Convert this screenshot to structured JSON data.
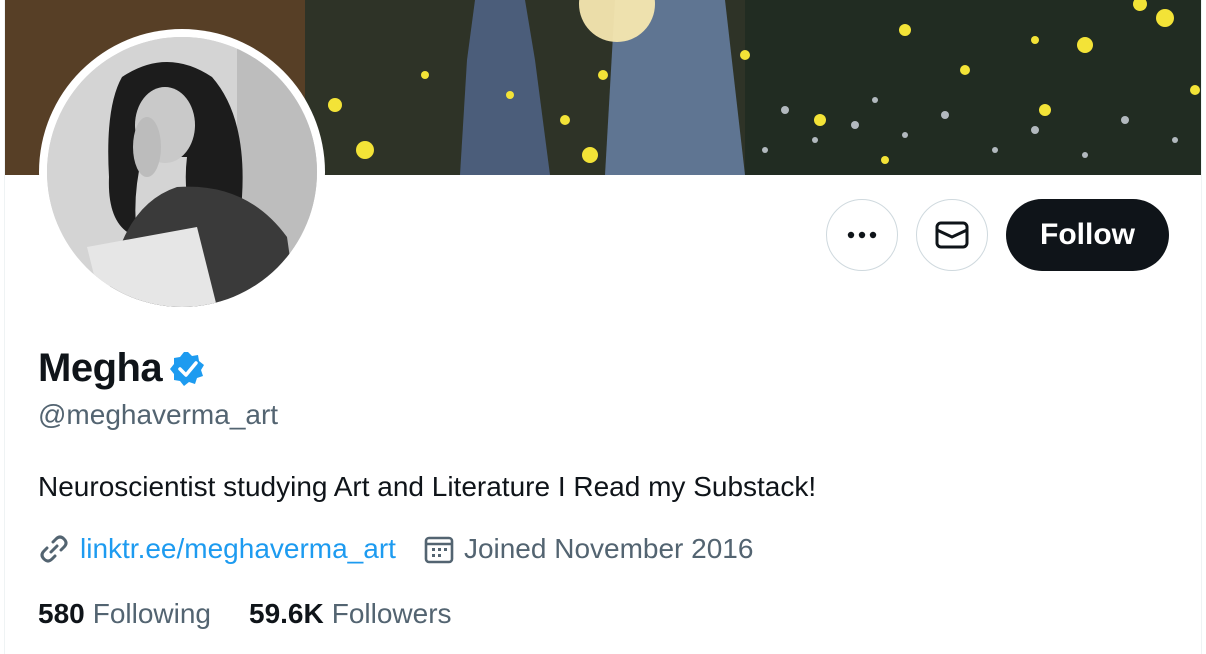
{
  "profile": {
    "display_name": "Megha",
    "verified": true,
    "handle": "@meghaverma_art",
    "bio": "Neuroscientist studying Art and Literature I Read my Substack!",
    "link": "linktr.ee/meghaverma_art",
    "joined": "Joined November 2016"
  },
  "actions": {
    "more_icon": "more-icon",
    "message_icon": "envelope-icon",
    "follow_label": "Follow"
  },
  "stats": {
    "following_count": "580",
    "following_label": "Following",
    "followers_count": "59.6K",
    "followers_label": "Followers"
  },
  "icons": {
    "verified": "verified-badge-icon",
    "link": "link-icon",
    "calendar": "calendar-icon"
  },
  "colors": {
    "accent": "#1d9bf0",
    "text_primary": "#0f1419",
    "text_secondary": "#536471",
    "follow_bg": "#0f1419",
    "border": "#cfd9de"
  }
}
